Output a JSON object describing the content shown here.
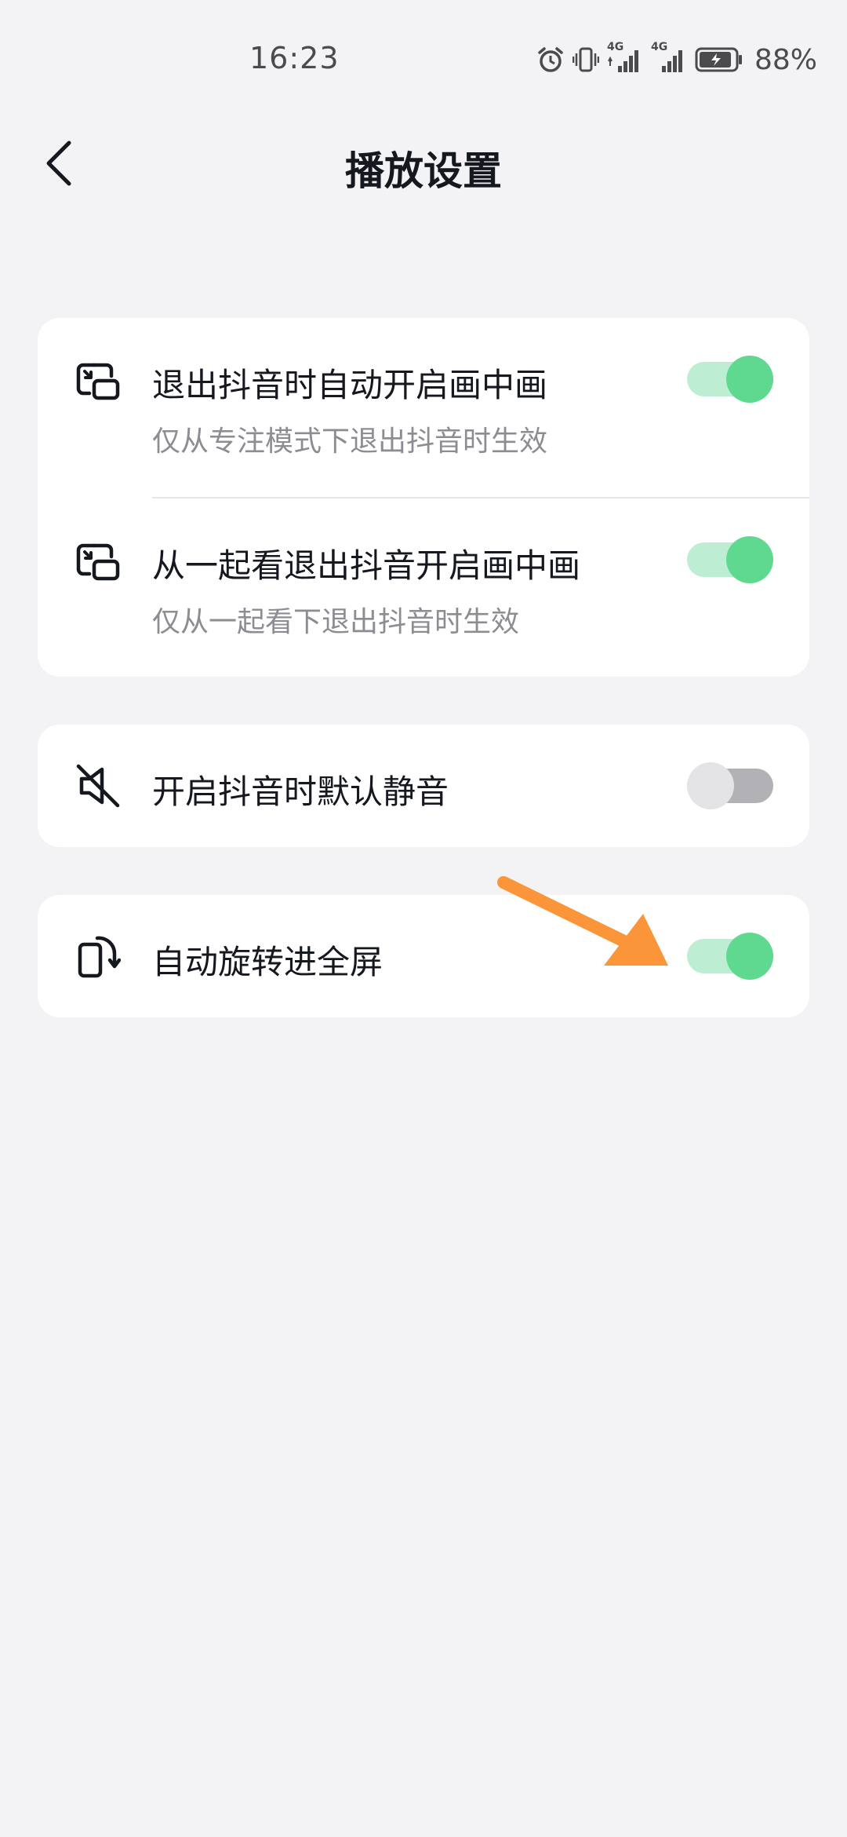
{
  "status_bar": {
    "time": "16:23",
    "battery": "88%",
    "signal_1_label": "4G",
    "signal_2_label": "4G",
    "icons": [
      "alarm-icon",
      "vibrate-icon",
      "signal-icon",
      "signal-icon",
      "battery-icon"
    ]
  },
  "header": {
    "title": "播放设置",
    "back_icon": "chevron-left-icon"
  },
  "settings": [
    {
      "icon": "picture-in-picture-icon",
      "title": "退出抖音时自动开启画中画",
      "subtitle": "仅从专注模式下退出抖音时生效",
      "enabled": true
    },
    {
      "icon": "picture-in-picture-icon",
      "title": "从一起看退出抖音开启画中画",
      "subtitle": "仅从一起看下退出抖音时生效",
      "enabled": true
    },
    {
      "icon": "mute-icon",
      "title": "开启抖音时默认静音",
      "enabled": false
    },
    {
      "icon": "auto-rotate-icon",
      "title": "自动旋转进全屏",
      "enabled": true
    }
  ],
  "colors": {
    "background": "#f3f3f5",
    "card": "#ffffff",
    "toggle_on_knob": "#5fd98f",
    "toggle_on_track": "#bdeed3",
    "toggle_off_knob": "#e4e4e7",
    "toggle_off_track": "#b1b1b6",
    "annotation_arrow": "#fb953a"
  }
}
